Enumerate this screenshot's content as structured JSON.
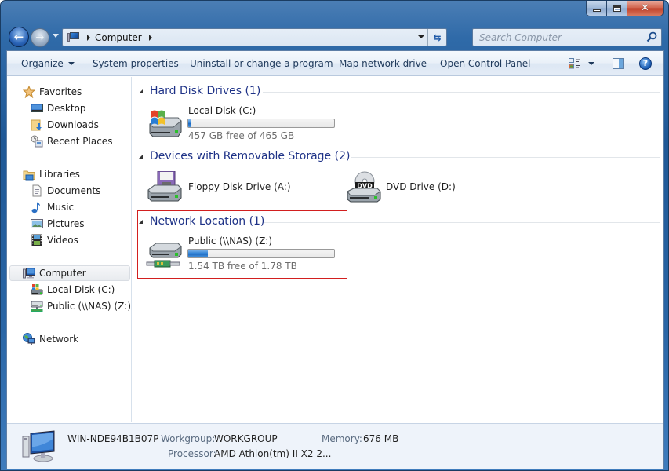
{
  "window": {
    "caption_buttons": {
      "minimize": "minimize",
      "maximize": "maximize",
      "close": "close"
    }
  },
  "navigation": {
    "back_icon": "back-arrow-icon",
    "forward_icon": "forward-arrow-icon",
    "breadcrumb": [
      "Computer"
    ],
    "search_placeholder": "Search Computer"
  },
  "toolbar": {
    "organize": "Organize",
    "system_properties": "System properties",
    "uninstall": "Uninstall or change a program",
    "map_drive": "Map network drive",
    "control_panel": "Open Control Panel",
    "help_glyph": "?"
  },
  "sidebar": {
    "favorites": {
      "label": "Favorites",
      "items": [
        {
          "label": "Desktop"
        },
        {
          "label": "Downloads"
        },
        {
          "label": "Recent Places"
        }
      ]
    },
    "libraries": {
      "label": "Libraries",
      "items": [
        {
          "label": "Documents"
        },
        {
          "label": "Music"
        },
        {
          "label": "Pictures"
        },
        {
          "label": "Videos"
        }
      ]
    },
    "computer": {
      "label": "Computer",
      "selected": true,
      "items": [
        {
          "label": "Local Disk (C:)"
        },
        {
          "label": "Public (\\\\NAS) (Z:)"
        }
      ]
    },
    "network": {
      "label": "Network"
    }
  },
  "groups": {
    "hdd": {
      "title": "Hard Disk Drives (1)",
      "drives": [
        {
          "name": "Local Disk (C:)",
          "free_text": "457 GB free of 465 GB",
          "used_fraction": 0.017
        }
      ]
    },
    "removable": {
      "title": "Devices with Removable Storage (2)",
      "drives": [
        {
          "name": "Floppy Disk Drive (A:)"
        },
        {
          "name": "DVD Drive (D:)",
          "badge": "DVD"
        }
      ]
    },
    "network": {
      "title": "Network Location (1)",
      "highlighted": true,
      "drives": [
        {
          "name": "Public (\\\\NAS) (Z:)",
          "free_text": "1.54 TB free of 1.78 TB",
          "used_fraction": 0.135
        }
      ]
    }
  },
  "details": {
    "computer_name": "WIN-NDE94B1B07P",
    "workgroup_label": "Workgroup:",
    "workgroup": "WORKGROUP",
    "memory_label": "Memory:",
    "memory": "676 MB",
    "processor_label": "Processor:",
    "processor": "AMD Athlon(tm) II X2 2..."
  },
  "colors": {
    "accent": "#1e3287",
    "highlight_box": "#d21f1f",
    "progress_fill": "#2a7ed4"
  }
}
